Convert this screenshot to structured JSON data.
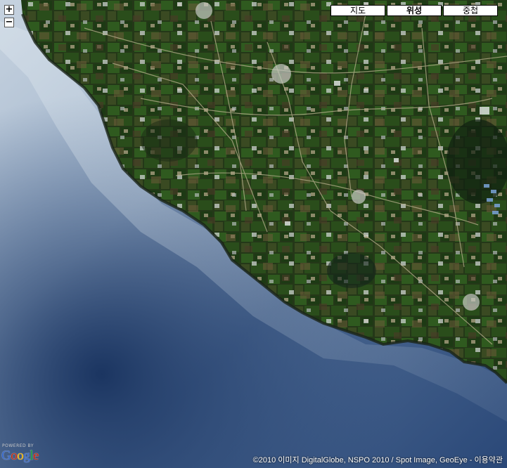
{
  "map": {
    "view": "satellite",
    "zoom_in_label": "+",
    "zoom_out_label": "−",
    "map_types": [
      {
        "label": "지도",
        "active": false
      },
      {
        "label": "위성",
        "active": true
      },
      {
        "label": "중첩",
        "active": false
      }
    ],
    "logo": {
      "powered_by": "POWERED BY",
      "letters": [
        "G",
        "o",
        "o",
        "g",
        "l",
        "e"
      ],
      "letter_colors": [
        "#3366cc",
        "#cc2200",
        "#f5b400",
        "#3366cc",
        "#119933",
        "#cc2200"
      ]
    },
    "copyright": {
      "text": "©2010 이미지 DigitalGlobe, NSPO 2010 / Spot Image, GeoEye - ",
      "terms_link": "이용약관"
    }
  }
}
